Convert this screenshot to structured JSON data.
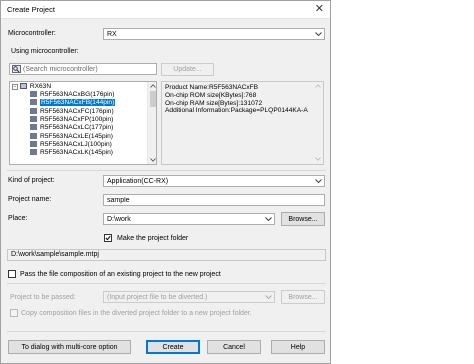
{
  "window": {
    "title": "Create Project",
    "close_symbol": "✕"
  },
  "microcontroller": {
    "label": "Microcontroller:",
    "value": "RX"
  },
  "using_mcu": {
    "label": "Using microcontroller:"
  },
  "search": {
    "placeholder": "(Search microcontroller)",
    "update_label": "Update..."
  },
  "tree": {
    "group": "RX63N",
    "expand_symbol": "−",
    "items": [
      {
        "label": "R5F563NACxBG(176pin)",
        "selected": false
      },
      {
        "label": "R5F563NACxFB(144pin)",
        "selected": true
      },
      {
        "label": "R5F563NACxFC(176pin)",
        "selected": false
      },
      {
        "label": "R5F563NACxFP(100pin)",
        "selected": false
      },
      {
        "label": "R5F563NACxLC(177pin)",
        "selected": false
      },
      {
        "label": "R5F563NACxLE(145pin)",
        "selected": false
      },
      {
        "label": "R5F563NACxLJ(100pin)",
        "selected": false
      },
      {
        "label": "R5F563NACxLK(145pin)",
        "selected": false
      }
    ]
  },
  "info": {
    "product_name": "Product Name:R5F563NACxFB",
    "rom": "On-chip ROM size[KBytes]:768",
    "ram": "On-chip RAM size[Bytes]:131072",
    "additional": "Additional Information:Package=PLQP0144KA-A"
  },
  "kind": {
    "label": "Kind of project:",
    "value": "Application(CC-RX)"
  },
  "project_name": {
    "label": "Project name:",
    "value": "sample"
  },
  "place": {
    "label": "Place:",
    "value": "D:\\work",
    "browse_label": "Browse..."
  },
  "make_folder": {
    "label": "Make the project folder",
    "checked": true
  },
  "project_path": "D:\\work\\sample\\sample.mtpj",
  "pass_composition": {
    "label": "Pass the file composition of an existing project to the new project",
    "checked": false
  },
  "project_to_pass": {
    "label": "Project to be passed:",
    "placeholder": "(Input project file to be diverted.)",
    "browse_label": "Browse..."
  },
  "copy_files": {
    "label": "Copy composition files in the diverted project folder to a new project folder."
  },
  "footer": {
    "multicore_label": "To dialog with multi-core option",
    "create_label": "Create",
    "cancel_label": "Cancel",
    "help_label": "Help"
  }
}
